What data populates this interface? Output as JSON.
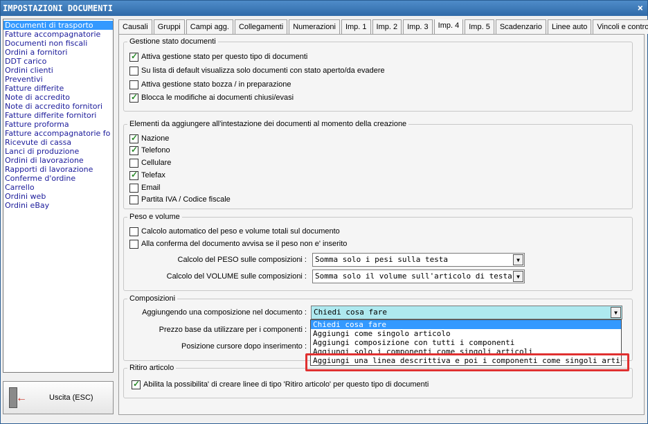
{
  "window": {
    "title": "IMPOSTAZIONI DOCUMENTI",
    "close_glyph": "×"
  },
  "doc_types": [
    "Documenti di trasporto",
    "Fatture accompagnatorie",
    "Documenti non fiscali",
    "Ordini a fornitori",
    "DDT carico",
    "Ordini clienti",
    "Preventivi",
    "Fatture differite",
    "Note di accredito",
    "Note di accredito fornitori",
    "Fatture differite fornitori",
    "Fatture proforma",
    "Fatture accompagnatorie fo",
    "Ricevute di cassa",
    "Lanci di produzione",
    "Ordini di lavorazione",
    "Rapporti di lavorazione",
    "Conferme d'ordine",
    "Carrello",
    "Ordini web",
    "Ordini eBay"
  ],
  "exit_button": {
    "label": "Uscita (ESC)",
    "icon": "exit-door-icon"
  },
  "tabs": [
    "Causali",
    "Gruppi",
    "Campi agg.",
    "Collegamenti",
    "Numerazioni",
    "Imp. 1",
    "Imp. 2",
    "Imp. 3",
    "Imp. 4",
    "Imp. 5",
    "Scadenzario",
    "Linee auto",
    "Vincoli e controlli"
  ],
  "active_tab": "Imp. 4",
  "gestione_stato": {
    "legend": "Gestione stato documenti",
    "items": [
      {
        "label": "Attiva gestione stato per questo tipo di documenti",
        "checked": true
      },
      {
        "label": "Su lista di default visualizza solo documenti con stato aperto/da evadere",
        "checked": false
      },
      {
        "label": "Attiva gestione stato bozza / in preparazione",
        "checked": false
      },
      {
        "label": "Blocca le modifiche ai documenti chiusi/evasi",
        "checked": true
      }
    ]
  },
  "intestazione": {
    "legend": "Elementi da aggiungere all'intestazione dei documenti al momento della creazione",
    "items": [
      {
        "label": "Nazione",
        "checked": true
      },
      {
        "label": "Telefono",
        "checked": true
      },
      {
        "label": "Cellulare",
        "checked": false
      },
      {
        "label": "Telefax",
        "checked": true
      },
      {
        "label": "Email",
        "checked": false
      },
      {
        "label": "Partita IVA / Codice fiscale",
        "checked": false
      }
    ]
  },
  "peso_volume": {
    "legend": "Peso e volume",
    "items": [
      {
        "label": "Calcolo automatico del peso e volume totali sul documento",
        "checked": false
      },
      {
        "label": "Alla conferma del documento avvisa se il peso non e' inserito",
        "checked": false
      }
    ],
    "peso_label": "Calcolo del PESO sulle composizioni :",
    "peso_value": "Somma solo i pesi sulla testa",
    "volume_label": "Calcolo del VOLUME sulle composizioni :",
    "volume_value": "Somma solo il volume sull'articolo di testa"
  },
  "composizioni": {
    "legend": "Composizioni",
    "aggiungendo_label": "Aggiungendo una composizione nel documento :",
    "aggiungendo_value": "Chiedi cosa fare",
    "prezzo_label": "Prezzo base da utilizzare per i componenti :",
    "posizione_label": "Posizione cursore dopo inserimento :",
    "options": [
      "Chiedi cosa fare",
      "Aggiungi come singolo articolo",
      "Aggiungi composizione con tutti i componenti",
      "Aggiungi solo i componenti come singoli articoli",
      "Aggiungi una linea descrittiva e poi i componenti come singoli articoli"
    ],
    "selected_option_index": 0
  },
  "ritiro": {
    "legend": "Ritiro articolo",
    "label": "Abilita la possibilita' di creare linee di tipo 'Ritiro articolo' per questo tipo di documenti",
    "checked": true
  },
  "colors": {
    "title_bar": "#2f6aa8",
    "selection": "#3399ff",
    "active_combo": "#aee9ef",
    "highlight_box": "#e03030"
  }
}
